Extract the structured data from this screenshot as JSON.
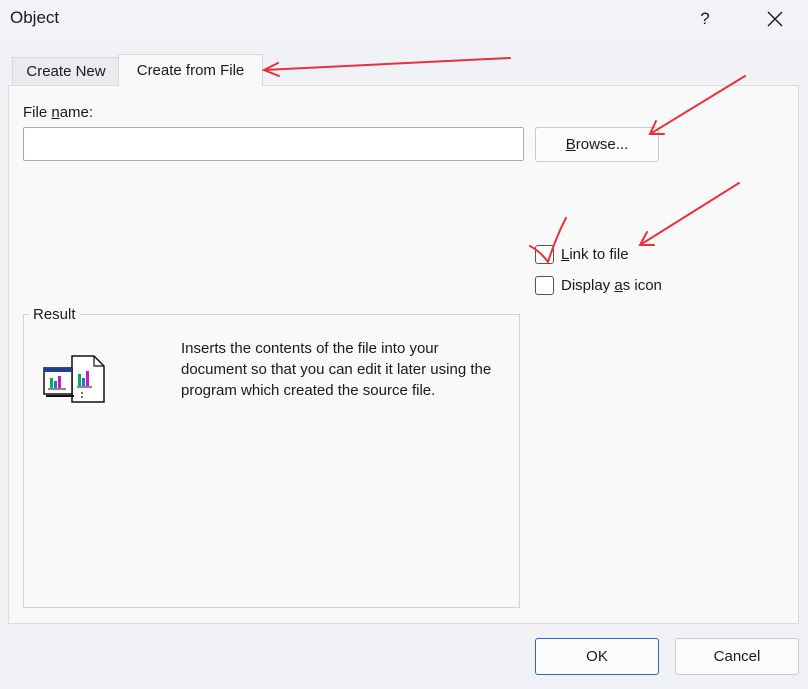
{
  "window": {
    "title": "Object",
    "help_label": "?"
  },
  "tabs": [
    {
      "label": "Create New",
      "selected": false
    },
    {
      "label": "Create from File",
      "selected": true
    }
  ],
  "file_name": {
    "label_pre": "File ",
    "label_ul": "n",
    "label_post": "ame:",
    "value": "",
    "placeholder": ""
  },
  "browse": {
    "label_ul": "B",
    "label_post": "rowse..."
  },
  "options": {
    "link_to_file": {
      "label_ul": "L",
      "label_post": "ink to file",
      "checked": false
    },
    "display_as_icon": {
      "label_pre": "Display ",
      "label_ul": "a",
      "label_post": "s icon",
      "checked": false
    }
  },
  "result": {
    "legend": "Result",
    "icon": "embedded-file-icon",
    "description": "Inserts the contents of the file into your document so that you can edit it later using the program which created the source file."
  },
  "footer": {
    "ok_label": "OK",
    "cancel_label": "Cancel"
  },
  "annotations": {
    "color": "#e8313f"
  },
  "colors": {
    "accent": "#2f66c9"
  }
}
